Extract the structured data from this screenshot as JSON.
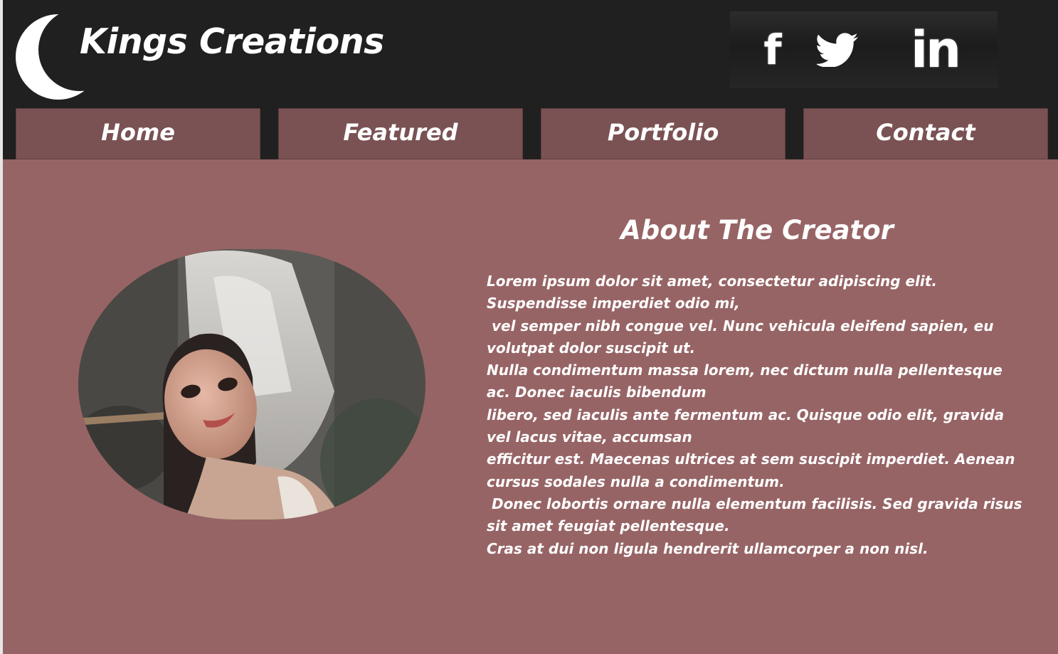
{
  "brand": {
    "title": "Kings Creations",
    "logo_icon": "crescent-moon-icon"
  },
  "social": [
    {
      "name": "facebook",
      "label": "f",
      "icon": "facebook-icon"
    },
    {
      "name": "twitter",
      "label": "",
      "icon": "twitter-bird-icon"
    },
    {
      "name": "linkedin",
      "label": "in",
      "icon": "linkedin-icon"
    }
  ],
  "nav": {
    "home": "Home",
    "featured": "Featured",
    "portfolio": "Portfolio",
    "contact": "Contact"
  },
  "about": {
    "title": "About The Creator",
    "lines": [
      "Lorem ipsum dolor sit amet, consectetur adipiscing elit. Suspendisse imperdiet odio mi,",
      " vel semper nibh congue vel. Nunc vehicula eleifend sapien, eu volutpat dolor suscipit ut.",
      "Nulla condimentum massa lorem, nec dictum nulla pellentesque ac. Donec iaculis bibendum",
      "libero, sed iaculis ante fermentum ac. Quisque odio elit, gravida vel lacus vitae, accumsan",
      "efficitur est. Maecenas ultrices at sem suscipit imperdiet. Aenean cursus sodales nulla a condimentum.",
      " Donec lobortis ornare nulla elementum facilisis. Sed gravida risus sit amet feugiat pellentesque.",
      "Cras at dui non ligula hendrerit ullamcorper a non nisl."
    ]
  },
  "colors": {
    "header_bg": "#202020",
    "page_bg": "#976465",
    "nav_bg": "#7a5253",
    "text": "#ffffff"
  }
}
